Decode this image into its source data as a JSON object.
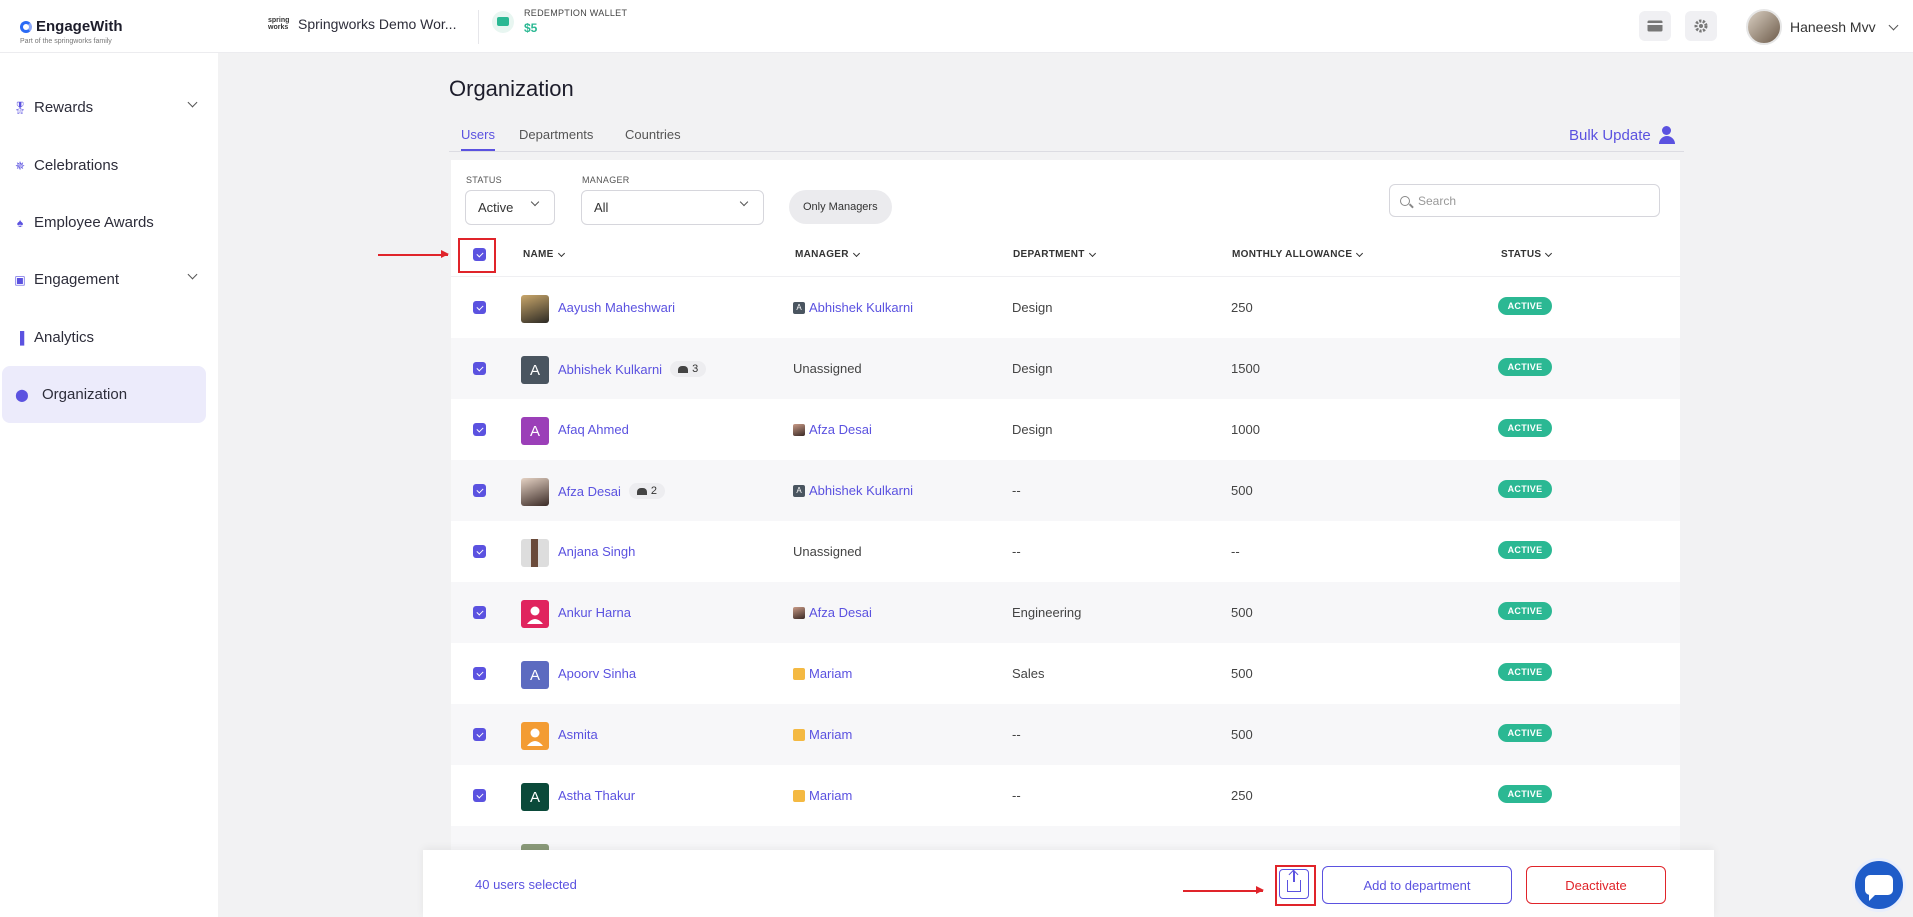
{
  "brand": {
    "name": "EngageWith",
    "tagline": "Part of the springworks family"
  },
  "workspace": {
    "logo_text": "spring works",
    "name": "Springworks Demo Wor..."
  },
  "wallet": {
    "label": "REDEMPTION WALLET",
    "amount": "$5"
  },
  "header": {
    "card_icon": "credit-card-icon",
    "settings_icon": "gear-icon",
    "user_name": "Haneesh Mvv"
  },
  "sidebar": {
    "items": [
      {
        "label": "Rewards",
        "icon": "medal-icon",
        "expandable": true
      },
      {
        "label": "Celebrations",
        "icon": "party-popper-icon",
        "expandable": false
      },
      {
        "label": "Employee Awards",
        "icon": "trophy-icon",
        "expandable": false
      },
      {
        "label": "Engagement",
        "icon": "engagement-icon",
        "expandable": true
      },
      {
        "label": "Analytics",
        "icon": "bar-chart-icon",
        "expandable": false
      },
      {
        "label": "Organization",
        "icon": "people-icon",
        "expandable": false,
        "active": true
      }
    ]
  },
  "page": {
    "title": "Organization",
    "bulk_update": "Bulk Update"
  },
  "tabs": [
    {
      "label": "Users",
      "active": true
    },
    {
      "label": "Departments",
      "active": false
    },
    {
      "label": "Countries",
      "active": false
    }
  ],
  "filters": {
    "status_label": "STATUS",
    "status_value": "Active",
    "manager_label": "MANAGER",
    "manager_value": "All",
    "only_managers": "Only Managers",
    "search_placeholder": "Search"
  },
  "table": {
    "columns": [
      "NAME",
      "MANAGER",
      "DEPARTMENT",
      "MONTHLY ALLOWANCE",
      "STATUS"
    ],
    "rows": [
      {
        "name": "Aayush Maheshwari",
        "avatar": "photo",
        "manager": "Abhishek Kulkarni",
        "manager_avatar": "A",
        "department": "Design",
        "allowance": "250",
        "status": "ACTIVE"
      },
      {
        "name": "Abhishek Kulkarni",
        "avatar": "A",
        "reports": "3",
        "manager": "Unassigned",
        "department": "Design",
        "allowance": "1500",
        "status": "ACTIVE"
      },
      {
        "name": "Afaq Ahmed",
        "avatar": "A",
        "manager": "Afza Desai",
        "manager_avatar": "photo",
        "department": "Design",
        "allowance": "1000",
        "status": "ACTIVE"
      },
      {
        "name": "Afza Desai",
        "avatar": "photo",
        "reports": "2",
        "manager": "Abhishek Kulkarni",
        "manager_avatar": "A",
        "department": "--",
        "allowance": "500",
        "status": "ACTIVE"
      },
      {
        "name": "Anjana Singh",
        "avatar": "photo",
        "manager": "Unassigned",
        "department": "--",
        "allowance": "--",
        "status": "ACTIVE"
      },
      {
        "name": "Ankur Harna",
        "avatar": "person",
        "manager": "Afza Desai",
        "manager_avatar": "photo",
        "department": "Engineering",
        "allowance": "500",
        "status": "ACTIVE"
      },
      {
        "name": "Apoorv Sinha",
        "avatar": "A",
        "manager": "Mariam",
        "manager_avatar": "person",
        "department": "Sales",
        "allowance": "500",
        "status": "ACTIVE"
      },
      {
        "name": "Asmita",
        "avatar": "person",
        "manager": "Mariam",
        "manager_avatar": "person",
        "department": "--",
        "allowance": "500",
        "status": "ACTIVE"
      },
      {
        "name": "Astha Thakur",
        "avatar": "A",
        "manager": "Mariam",
        "manager_avatar": "person",
        "department": "--",
        "allowance": "250",
        "status": "ACTIVE"
      }
    ]
  },
  "bottom_bar": {
    "selected": "40 users selected",
    "export_icon": "export-icon",
    "add_to_department": "Add to department",
    "deactivate": "Deactivate"
  },
  "colors": {
    "accent": "#5b52e0",
    "active_green": "#2bb893",
    "danger": "#e0242a"
  }
}
